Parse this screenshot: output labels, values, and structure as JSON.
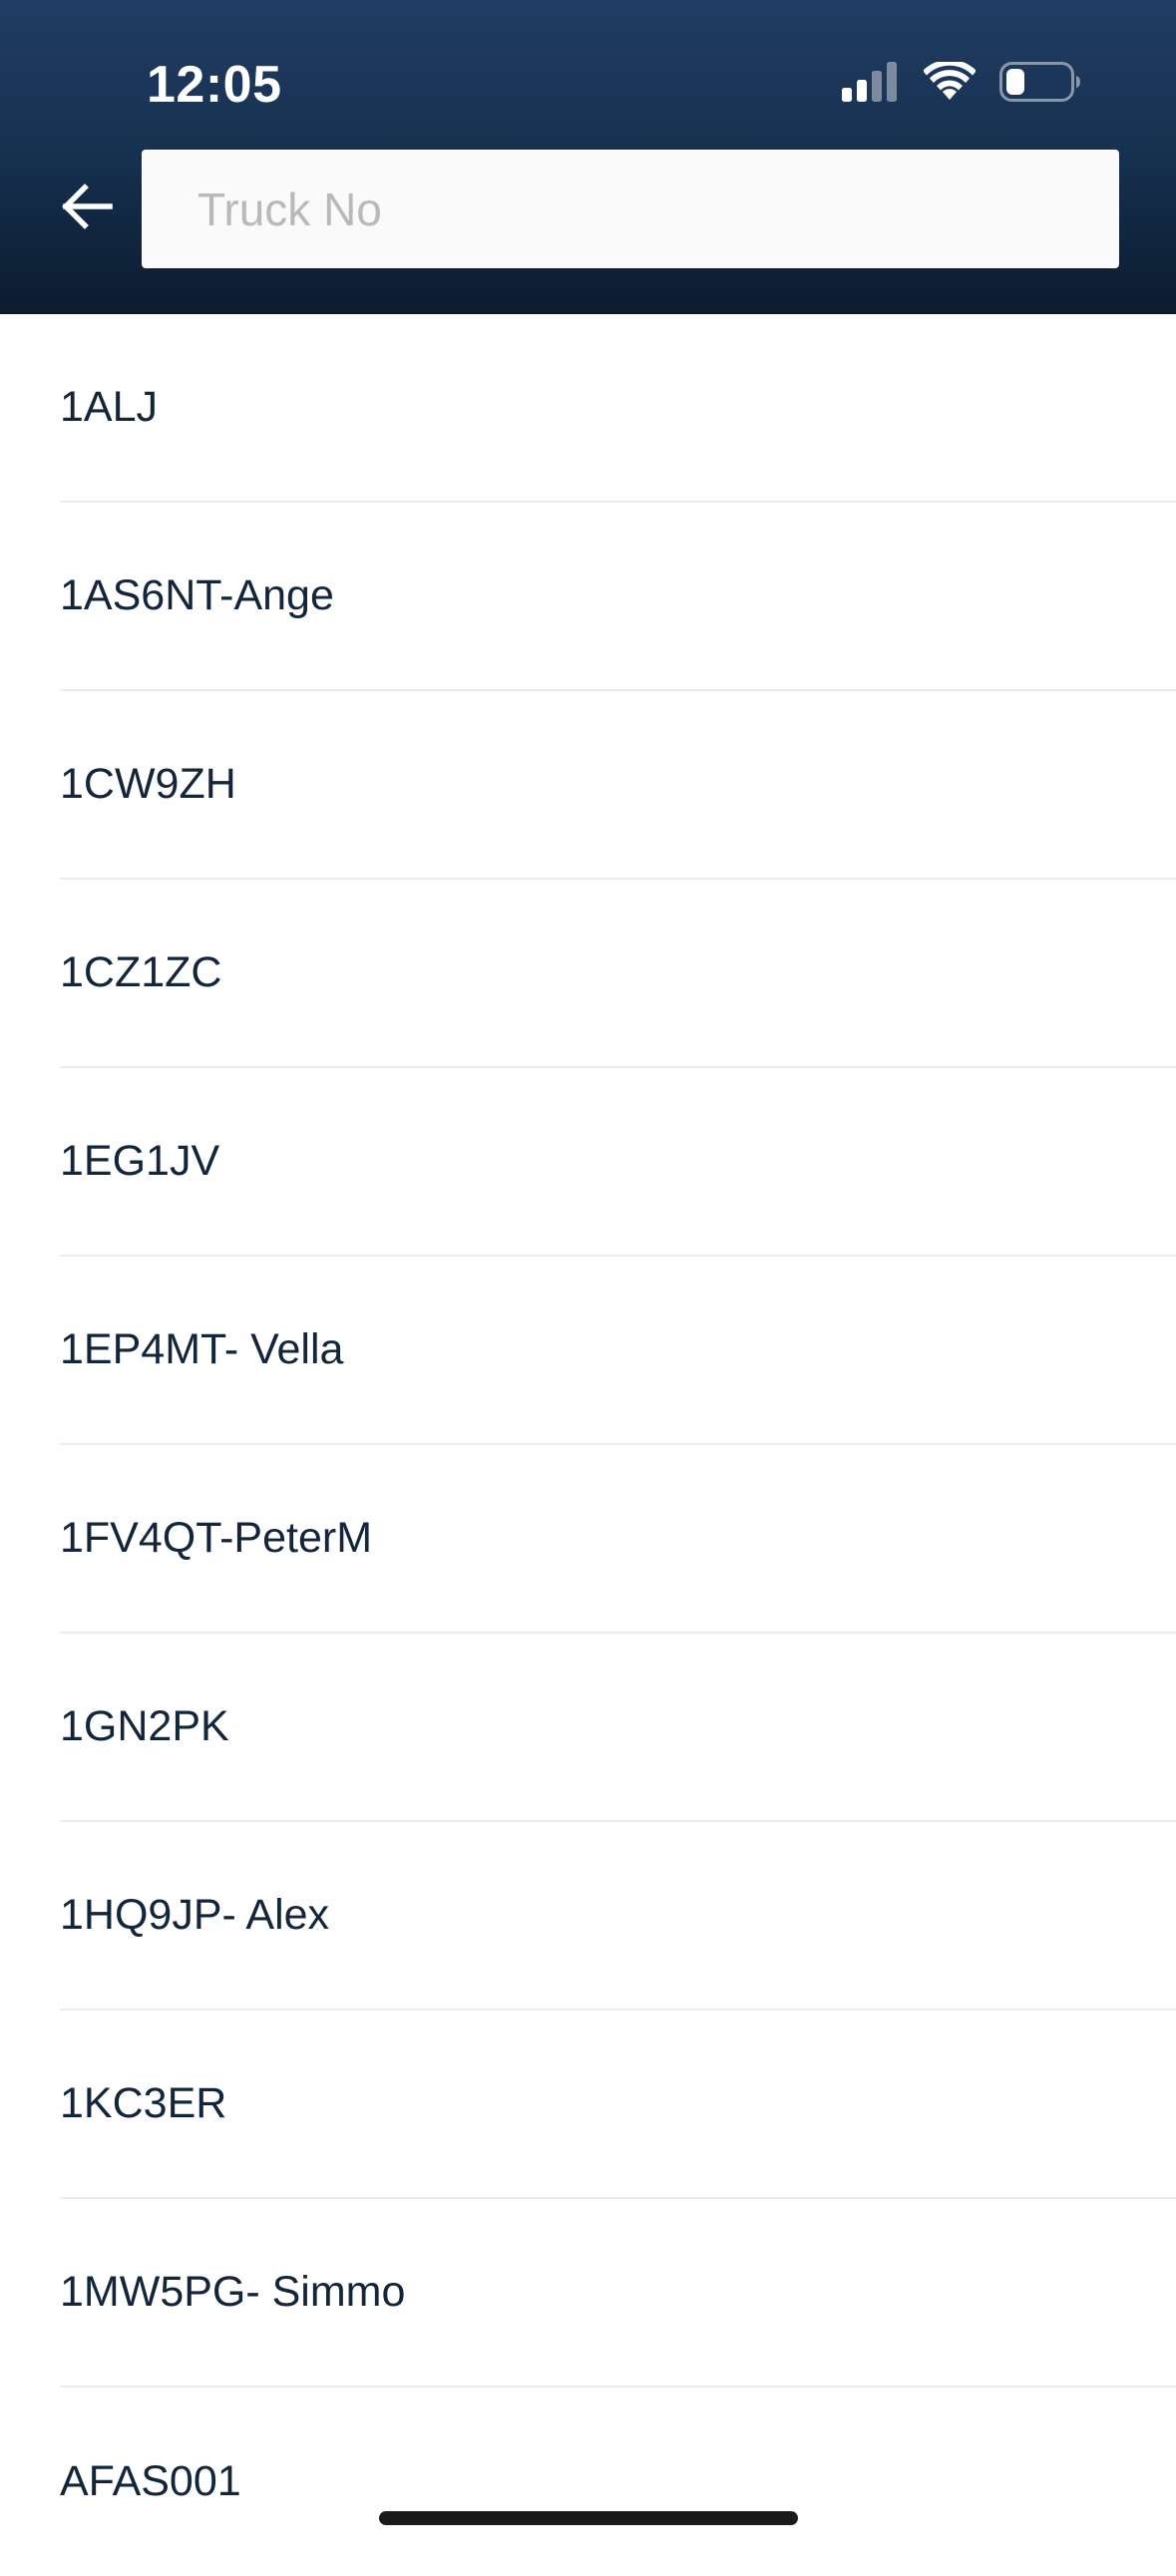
{
  "status_bar": {
    "time": "12:05",
    "signal_icon": "cellular-signal-icon",
    "wifi_icon": "wifi-icon",
    "battery_icon": "battery-icon"
  },
  "header": {
    "back_icon": "arrow-left-icon",
    "search": {
      "placeholder": "Truck No",
      "value": ""
    },
    "gradient_top": "#213d63",
    "gradient_bottom": "#0b1b2e"
  },
  "list": {
    "items": [
      {
        "label": "1ALJ"
      },
      {
        "label": "1AS6NT-Ange"
      },
      {
        "label": "1CW9ZH"
      },
      {
        "label": "1CZ1ZC"
      },
      {
        "label": "1EG1JV"
      },
      {
        "label": "1EP4MT- Vella"
      },
      {
        "label": "1FV4QT-PeterM"
      },
      {
        "label": "1GN2PK"
      },
      {
        "label": "1HQ9JP- Alex"
      },
      {
        "label": "1KC3ER"
      },
      {
        "label": "1MW5PG- Simmo"
      },
      {
        "label": "AFAS001"
      }
    ]
  }
}
